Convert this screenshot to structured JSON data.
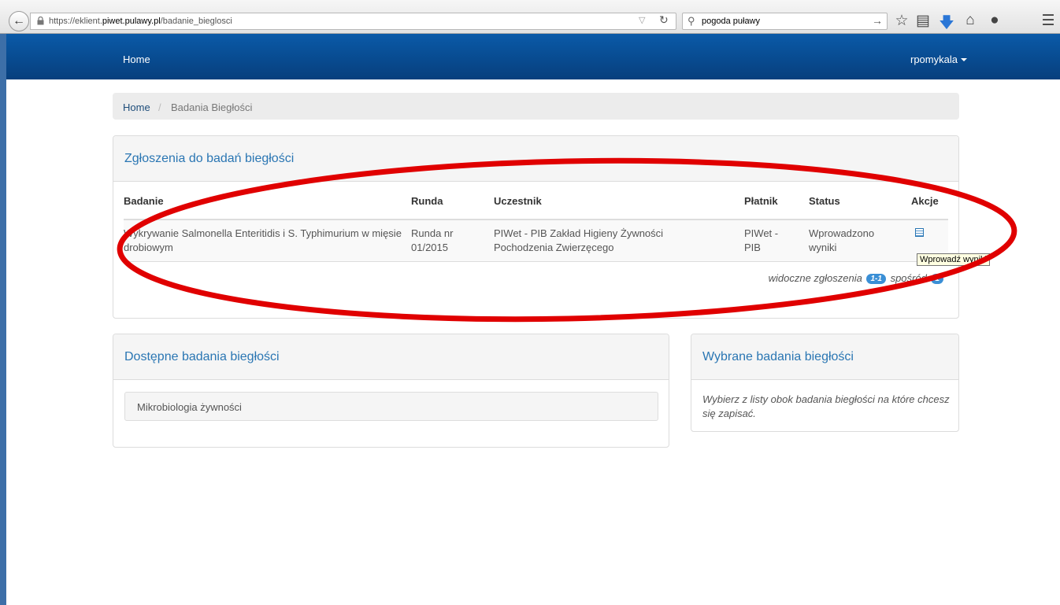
{
  "browser": {
    "url_prefix": "https://eklient.",
    "url_domain": "piwet.pulawy.pl",
    "url_path": "/badanie_bieglosci",
    "search_value": "pogoda puławy"
  },
  "navbar": {
    "home_label": "Home",
    "user_label": "rpomykala"
  },
  "breadcrumb": {
    "home": "Home",
    "separator": "/",
    "current": "Badania Biegłości"
  },
  "applications_panel": {
    "title": "Zgłoszenia do badań biegłości",
    "columns": [
      "Badanie",
      "Runda",
      "Uczestnik",
      "Płatnik",
      "Status",
      "Akcje"
    ],
    "rows": [
      {
        "badanie": "Wykrywanie Salmonella Enteritidis i S. Typhimurium w mięsie drobiowym",
        "runda": "Runda nr 01/2015",
        "uczestnik": "PIWet - PIB Zakład Higieny Żywności Pochodzenia Zwierzęcego",
        "platnik": "PIWet - PIB",
        "status": "Wprowadzono wyniki",
        "action_icon": "list-icon"
      }
    ],
    "pager_prefix": "widoczne zgłoszenia",
    "pager_range": "1-1",
    "pager_middle": "spośród",
    "pager_total": "1",
    "tooltip": "Wprowadź wyniki"
  },
  "available_panel": {
    "title": "Dostępne badania biegłości",
    "items": [
      "Mikrobiologia żywności"
    ]
  },
  "selected_panel": {
    "title": "Wybrane badania biegłości",
    "hint": "Wybierz z listy obok badania biegłości na które chcesz się zapisać."
  },
  "colors": {
    "navbar": "#073f7d",
    "panel_title": "#2a76b3",
    "annotation": "#e00000",
    "badge": "#3a8fd6"
  }
}
